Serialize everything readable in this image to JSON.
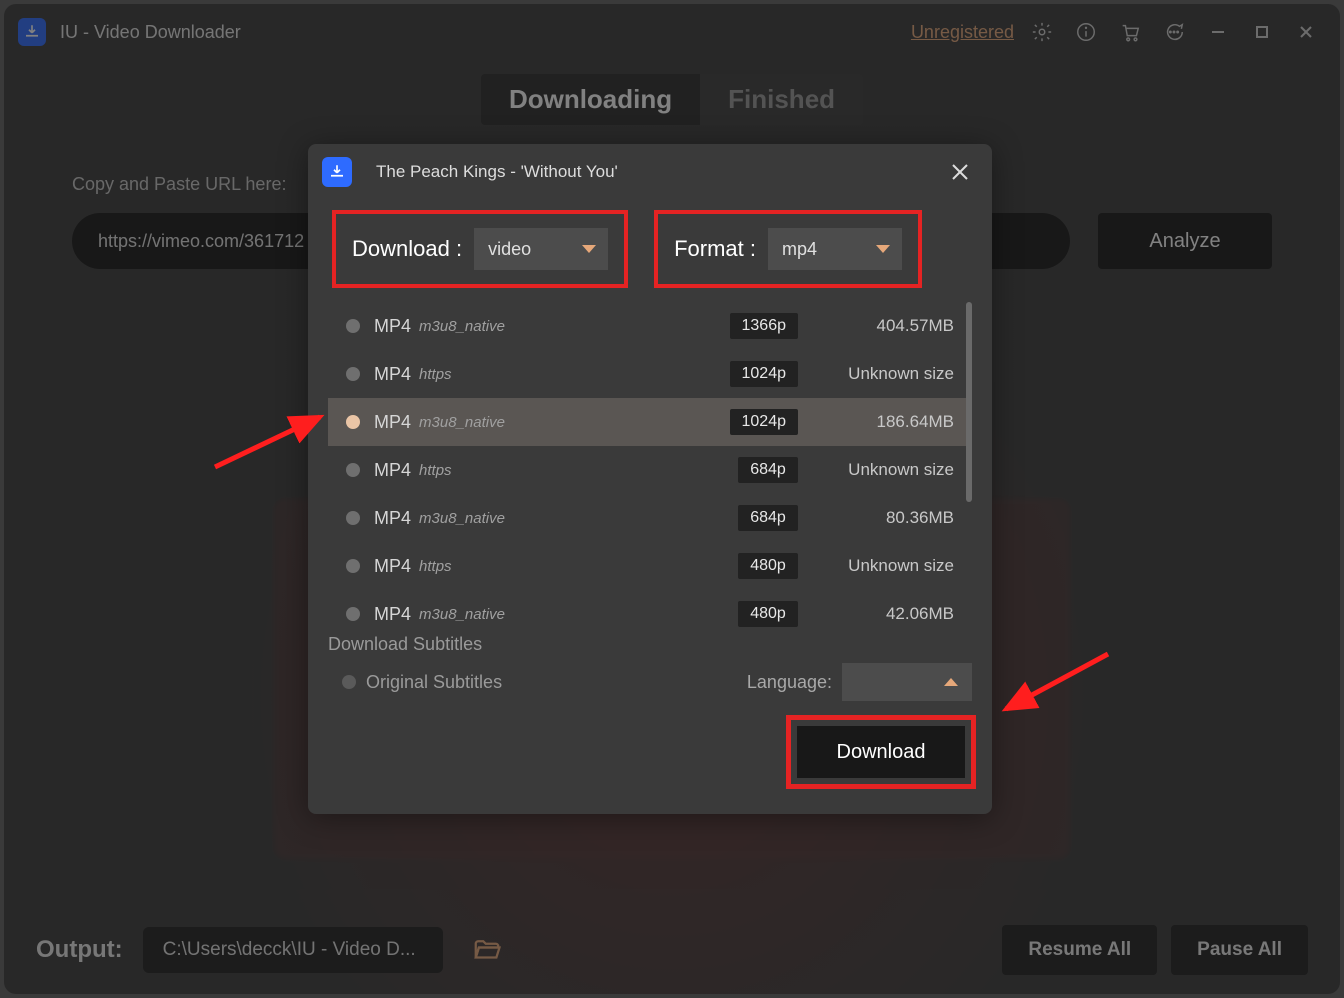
{
  "window": {
    "title": "IU - Video Downloader",
    "unregistered": "Unregistered"
  },
  "tabs": {
    "downloading": "Downloading",
    "finished": "Finished"
  },
  "input": {
    "label": "Copy and Paste URL here:",
    "value": "https://vimeo.com/361712",
    "analyze": "Analyze"
  },
  "dialog": {
    "title": "The Peach Kings - 'Without You'",
    "download_label": "Download :",
    "download_value": "video",
    "format_label": "Format :",
    "format_value": "mp4",
    "options": [
      {
        "fmt": "MP4",
        "src": "m3u8_native",
        "res": "1366p",
        "size": "404.57MB",
        "selected": false
      },
      {
        "fmt": "MP4",
        "src": "https",
        "res": "1024p",
        "size": "Unknown size",
        "selected": false
      },
      {
        "fmt": "MP4",
        "src": "m3u8_native",
        "res": "1024p",
        "size": "186.64MB",
        "selected": true
      },
      {
        "fmt": "MP4",
        "src": "https",
        "res": "684p",
        "size": "Unknown size",
        "selected": false
      },
      {
        "fmt": "MP4",
        "src": "m3u8_native",
        "res": "684p",
        "size": "80.36MB",
        "selected": false
      },
      {
        "fmt": "MP4",
        "src": "https",
        "res": "480p",
        "size": "Unknown size",
        "selected": false
      },
      {
        "fmt": "MP4",
        "src": "m3u8_native",
        "res": "480p",
        "size": "42.06MB",
        "selected": false
      }
    ],
    "subtitles_title": "Download Subtitles",
    "original_subs": "Original Subtitles",
    "language_label": "Language:",
    "download_btn": "Download"
  },
  "footer": {
    "output_label": "Output:",
    "path": "C:\\Users\\decck\\IU - Video D...",
    "resume": "Resume All",
    "pause": "Pause All"
  }
}
